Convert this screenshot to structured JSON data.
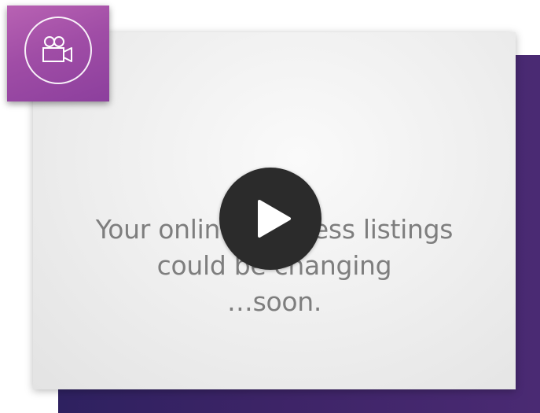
{
  "video": {
    "caption_lines": [
      "Your online business listings",
      "could be changing",
      "…soon."
    ]
  },
  "icons": {
    "badge": "video-camera-icon",
    "play": "play-icon"
  },
  "colors": {
    "backdrop": "#3d2467",
    "badge": "#a04da6",
    "play_button": "#2b2b2b",
    "caption_text": "#7e7e7e"
  }
}
